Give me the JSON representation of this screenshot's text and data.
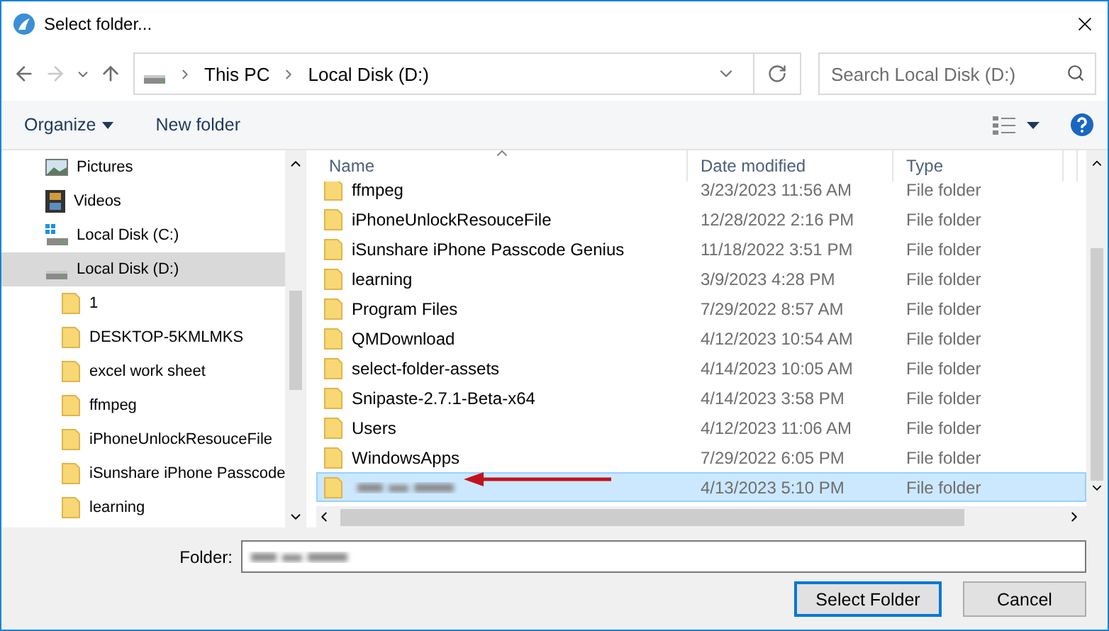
{
  "window": {
    "title": "Select folder..."
  },
  "nav": {
    "back": {
      "disabled": false
    },
    "forward": {
      "disabled": true
    },
    "breadcrumb": [
      "This PC",
      "Local Disk (D:)"
    ],
    "search": {
      "placeholder": "Search Local Disk (D:)"
    }
  },
  "toolbar": [
    {
      "label": "Organize",
      "kind": "menu"
    },
    {
      "label": "New folder",
      "kind": "button"
    }
  ],
  "sidebar": [
    {
      "label": "Pictures",
      "kind": "pictures",
      "selected": false
    },
    {
      "label": "Videos",
      "kind": "videos",
      "selected": false
    },
    {
      "label": "Local Disk (C:)",
      "kind": "system-drive",
      "selected": false
    },
    {
      "label": "Local Disk (D:)",
      "kind": "drive",
      "selected": true,
      "children": [
        {
          "label": "1",
          "kind": "folder",
          "selected": false
        },
        {
          "label": "DESKTOP-5KMLMKS",
          "kind": "folder",
          "selected": false
        },
        {
          "label": "excel work sheet",
          "kind": "folder",
          "selected": false
        },
        {
          "label": "ffmpeg",
          "kind": "folder",
          "selected": false
        },
        {
          "label": "iPhoneUnlockResouceFile",
          "kind": "folder",
          "selected": false
        },
        {
          "label": "iSunshare iPhone Passcode",
          "kind": "folder",
          "selected": false
        },
        {
          "label": "learning",
          "kind": "folder",
          "selected": false
        }
      ]
    }
  ],
  "table": {
    "columns": [
      {
        "label": "Name",
        "sorted": true
      },
      {
        "label": "Date modified",
        "sorted": false
      },
      {
        "label": "Type",
        "sorted": false
      }
    ],
    "rows": [
      {
        "kind": "folder",
        "name": "ffmpeg",
        "date": "3/23/2023 11:56 AM",
        "type": "File folder",
        "selected": false
      },
      {
        "kind": "folder",
        "name": "iPhoneUnlockResouceFile",
        "date": "12/28/2022 2:16 PM",
        "type": "File folder",
        "selected": false
      },
      {
        "kind": "folder",
        "name": "iSunshare iPhone Passcode Genius",
        "date": "11/18/2022 3:51 PM",
        "type": "File folder",
        "selected": false
      },
      {
        "kind": "folder",
        "name": "learning",
        "date": "3/9/2023 4:28 PM",
        "type": "File folder",
        "selected": false
      },
      {
        "kind": "folder",
        "name": "Program Files",
        "date": "7/29/2022 8:57 AM",
        "type": "File folder",
        "selected": false
      },
      {
        "kind": "folder",
        "name": "QMDownload",
        "date": "4/12/2023 10:54 AM",
        "type": "File folder",
        "selected": false
      },
      {
        "kind": "folder",
        "name": "select-folder-assets",
        "date": "4/14/2023 10:05 AM",
        "type": "File folder",
        "selected": false
      },
      {
        "kind": "folder",
        "name": "Snipaste-2.7.1-Beta-x64",
        "date": "4/14/2023 3:58 PM",
        "type": "File folder",
        "selected": false
      },
      {
        "kind": "folder",
        "name": "Users",
        "date": "4/12/2023 11:06 AM",
        "type": "File folder",
        "selected": false
      },
      {
        "kind": "folder",
        "name": "WindowsApps",
        "date": "7/29/2022 6:05 PM",
        "type": "File folder",
        "selected": false
      },
      {
        "kind": "redacted",
        "date": "4/13/2023 5:10 PM",
        "type": "File folder",
        "selected": true
      }
    ]
  },
  "annotation": {
    "kind": "arrow"
  },
  "folder_field": {
    "label": "Folder:",
    "kind": "redacted"
  },
  "buttons": [
    {
      "label": "Select Folder",
      "default": true
    },
    {
      "label": "Cancel",
      "default": false
    }
  ]
}
